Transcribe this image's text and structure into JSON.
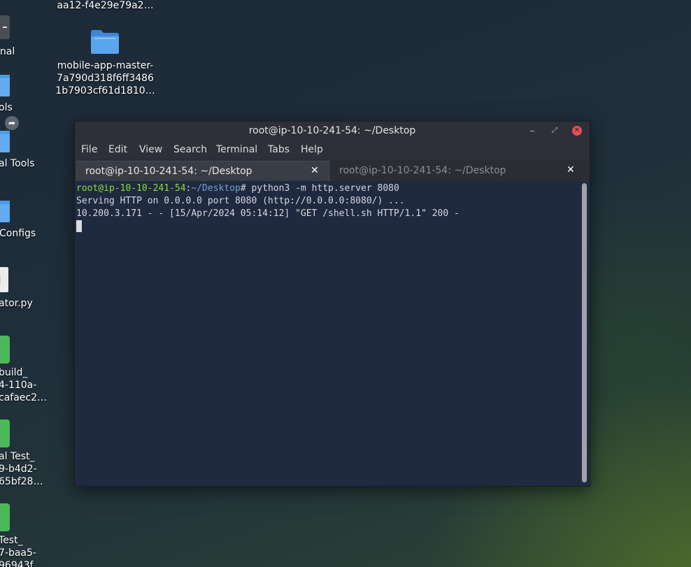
{
  "desktop": {
    "items": [
      {
        "label": "aa12-f4e29e79a2…"
      },
      {
        "label_lines": [
          "mobile-app-master-",
          "7a790d318f6ff3486",
          "1b7903cf61d1810…"
        ]
      },
      {
        "label": "inal"
      },
      {
        "label": "ols"
      },
      {
        "label": "al Tools"
      },
      {
        "label": "Configs"
      },
      {
        "label": "ator.py"
      },
      {
        "label_lines": [
          "build_",
          "4-110a-",
          "cafaec2…"
        ]
      },
      {
        "label_lines": [
          "al Test_",
          "9-b4d2-",
          "65bf28…"
        ]
      },
      {
        "label_lines": [
          "Test_",
          "7-baa5-",
          "96943f…"
        ]
      }
    ],
    "icons": {
      "folder": "folder-icon",
      "terminal": "terminal-icon",
      "script": "python-file-icon",
      "green": "document-icon",
      "shortcut": "shortcut-arrow-icon"
    },
    "colors": {
      "folder": "#4f9be8",
      "folder_light": "#7bb6f2",
      "green_doc": "#4db85a"
    }
  },
  "terminal": {
    "title": "root@ip-10-10-241-54: ~/Desktop",
    "window_controls": {
      "minimize": "‒",
      "maximize": "⤢",
      "close": "✕"
    },
    "menu": [
      "File",
      "Edit",
      "View",
      "Search",
      "Terminal",
      "Tabs",
      "Help"
    ],
    "tabs": [
      {
        "label": "root@ip-10-10-241-54: ~/Desktop",
        "active": true,
        "close": "✕"
      },
      {
        "label": "root@ip-10-10-241-54: ~/Desktop",
        "active": false,
        "close": "✕"
      }
    ],
    "output": {
      "prompt_user": "root@ip-10-10-241-54",
      "prompt_sep": ":",
      "prompt_path": "~/Desktop",
      "prompt_end": "# ",
      "command": "python3 -m http.server 8080",
      "lines": [
        "Serving HTTP on 0.0.0.0 port 8080 (http://0.0.0.0:8080/) ...",
        "10.200.3.171 - - [15/Apr/2024 05:14:12] \"GET /shell.sh HTTP/1.1\" 200 -"
      ]
    },
    "colors": {
      "background": "#1f2940",
      "prompt_user": "#8ae234",
      "prompt_path": "#729fcf",
      "text": "#d5d8de",
      "close_button": "#e84c5a"
    }
  }
}
